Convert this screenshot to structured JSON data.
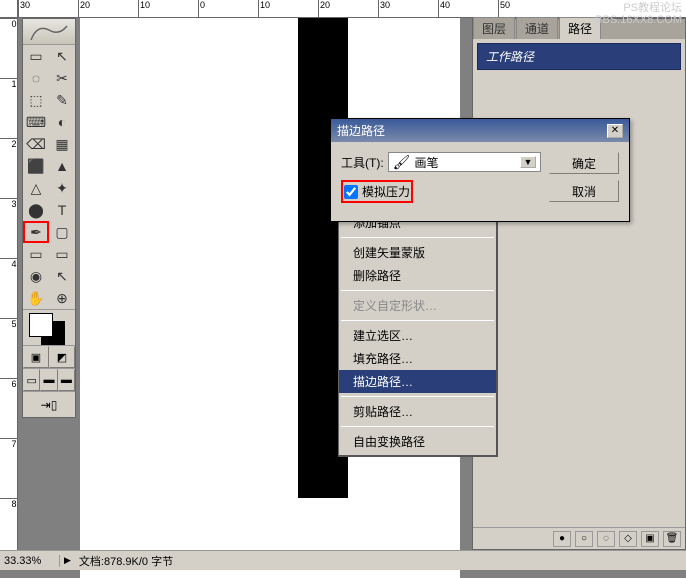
{
  "ruler_h": [
    "30",
    "20",
    "10",
    "0",
    "10",
    "20",
    "30",
    "40",
    "50"
  ],
  "ruler_v": [
    "0",
    "1",
    "2",
    "3",
    "4",
    "5",
    "6",
    "7",
    "8"
  ],
  "panel": {
    "tabs": [
      "图层",
      "通道",
      "路径"
    ],
    "active_tab": 2,
    "path_item": "工作路径"
  },
  "dialog": {
    "title": "描边路径",
    "tool_label": "工具(T):",
    "tool_value": "画笔",
    "simulate_pressure": "模拟压力",
    "ok": "确定",
    "cancel": "取消"
  },
  "context_menu": [
    {
      "label": "添加锚点",
      "enabled": true
    },
    {
      "sep": true
    },
    {
      "label": "创建矢量蒙版",
      "enabled": true
    },
    {
      "label": "删除路径",
      "enabled": true
    },
    {
      "sep": true
    },
    {
      "label": "定义自定形状…",
      "enabled": false
    },
    {
      "sep": true
    },
    {
      "label": "建立选区…",
      "enabled": true
    },
    {
      "label": "填充路径…",
      "enabled": true
    },
    {
      "label": "描边路径…",
      "enabled": true,
      "hover": true
    },
    {
      "sep": true
    },
    {
      "label": "剪贴路径…",
      "enabled": true
    },
    {
      "sep": true
    },
    {
      "label": "自由变换路径",
      "enabled": true
    }
  ],
  "statusbar": {
    "zoom": "33.33%",
    "info": "文档:878.9K/0 字节"
  },
  "watermark": {
    "line1": "PS教程论坛",
    "line2": "BBS.16XX8.COM"
  },
  "tool_icons": [
    "▭",
    "↖",
    "◌",
    "✂",
    "⬚",
    "✎",
    "⌨",
    "◐",
    "⌫",
    "▦",
    "⬛",
    "▲",
    "△",
    "✦",
    "⬤",
    "T",
    "✒",
    "▢",
    "▭",
    "▭",
    "◉",
    "↖",
    "✋",
    "⊕"
  ],
  "selected_tool_index": 16
}
